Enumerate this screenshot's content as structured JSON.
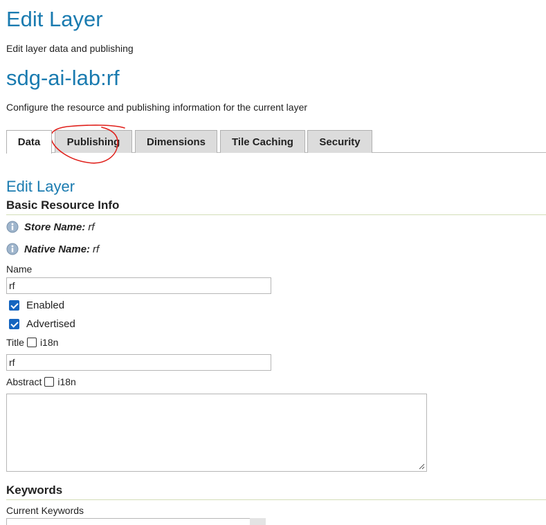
{
  "header": {
    "title": "Edit Layer",
    "subtitle": "Edit layer data and publishing",
    "layer_name": "sdg-ai-lab:rf",
    "description": "Configure the resource and publishing information for the current layer"
  },
  "tabs": [
    {
      "label": "Data",
      "active": true
    },
    {
      "label": "Publishing",
      "active": false
    },
    {
      "label": "Dimensions",
      "active": false
    },
    {
      "label": "Tile Caching",
      "active": false
    },
    {
      "label": "Security",
      "active": false
    }
  ],
  "section": {
    "title": "Edit Layer",
    "basic_info_heading": "Basic Resource Info",
    "store_label": "Store Name:",
    "store_value": "rf",
    "native_label": "Native Name:",
    "native_value": "rf"
  },
  "form": {
    "name_label": "Name",
    "name_value": "rf",
    "enabled_label": "Enabled",
    "enabled_checked": true,
    "advertised_label": "Advertised",
    "advertised_checked": true,
    "title_label": "Title",
    "title_i18n_label": "i18n",
    "title_value": "rf",
    "abstract_label": "Abstract",
    "abstract_i18n_label": "i18n",
    "abstract_value": ""
  },
  "keywords": {
    "heading": "Keywords",
    "current_label": "Current Keywords"
  },
  "colors": {
    "accent": "#1a7bb0",
    "checkbox": "#1565c0",
    "annotation": "#e0201b",
    "tab_bg": "#dcdcdc"
  }
}
